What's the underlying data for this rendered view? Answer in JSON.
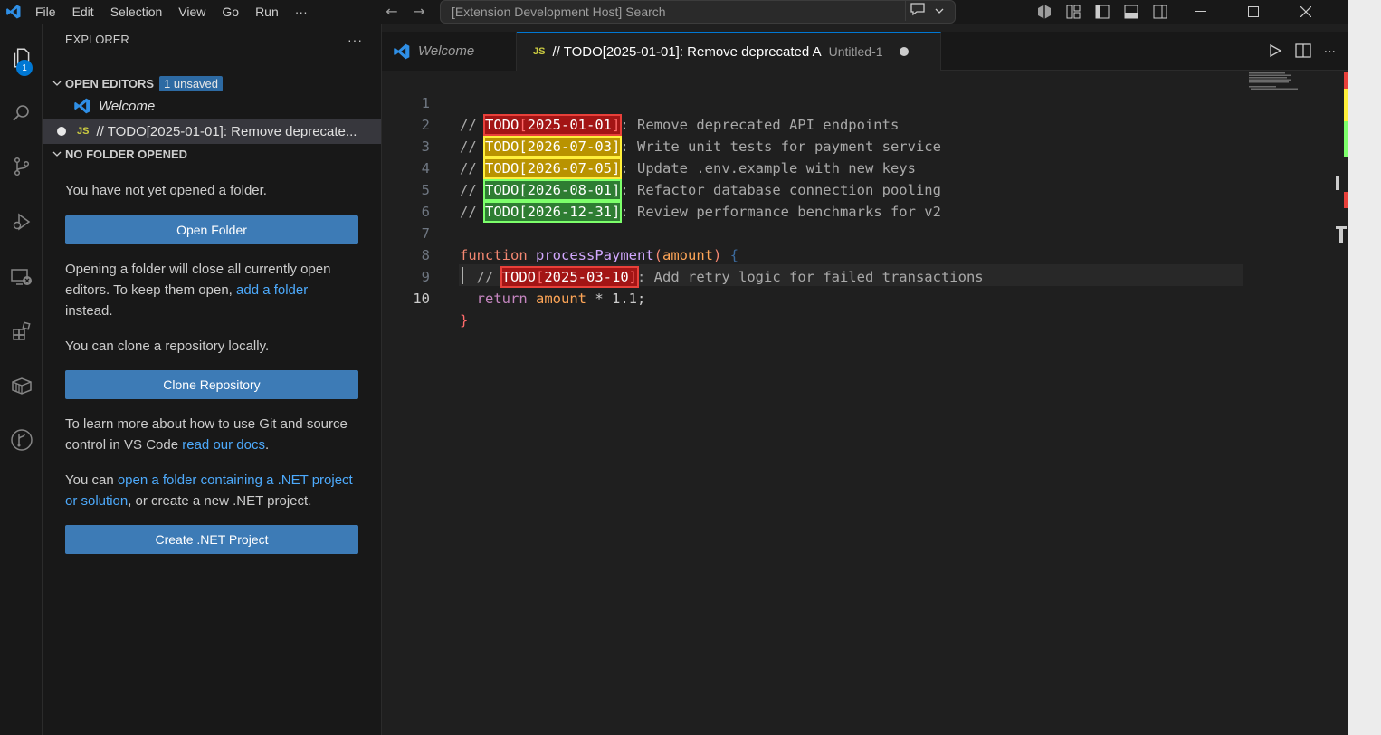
{
  "menu": [
    "File",
    "Edit",
    "Selection",
    "View",
    "Go",
    "Run"
  ],
  "menu_overflow": "···",
  "command_center": {
    "text": "[Extension Development Host] Search"
  },
  "activity": {
    "explorer_badge": "1"
  },
  "sidebar": {
    "title": "EXPLORER",
    "more": "···",
    "open_editors": {
      "title": "OPEN EDITORS",
      "badge": "1 unsaved",
      "items": [
        {
          "label": "Welcome",
          "icon": "vscode-icon"
        },
        {
          "label": "// TODO[2025-01-01]: Remove deprecate...",
          "icon": "js-icon",
          "icon_text": "JS"
        }
      ]
    },
    "no_folder": {
      "title": "NO FOLDER OPENED",
      "p1": "You have not yet opened a folder.",
      "open_folder": "Open Folder",
      "p2_a": "Opening a folder will close all currently open editors. To keep them open, ",
      "p2_link": "add a folder",
      "p2_b": " instead.",
      "p3": "You can clone a repository locally.",
      "clone": "Clone Repository",
      "p4_a": "To learn more about how to use Git and source control in VS Code ",
      "p4_link": "read our docs",
      "p4_b": ".",
      "p5_a": "You can ",
      "p5_link": "open a folder containing a .NET project or solution",
      "p5_b": ", or create a new .NET project.",
      "create_net": "Create .NET Project"
    }
  },
  "tabs": [
    {
      "label": "Welcome",
      "active": false
    },
    {
      "label": "// TODO[2025-01-01]: Remove deprecated A",
      "description": "Untitled-1",
      "active": true,
      "icon_text": "JS"
    }
  ],
  "code": {
    "line_numbers": [
      "1",
      "2",
      "3",
      "4",
      "5",
      "6",
      "7",
      "8",
      "9",
      "10"
    ],
    "todos": [
      {
        "prefix": "// ",
        "tag": "TODO",
        "date": "2025-01-01",
        "text": ": Remove deprecated API endpoints",
        "color": "red"
      },
      {
        "prefix": "// ",
        "tag": "TODO",
        "date": "2026-07-03",
        "text": ": Write unit tests for payment service",
        "color": "yellow"
      },
      {
        "prefix": "// ",
        "tag": "TODO",
        "date": "2026-07-05",
        "text": ": Update .env.example with new keys",
        "color": "yellow"
      },
      {
        "prefix": "// ",
        "tag": "TODO",
        "date": "2026-08-01",
        "text": ": Refactor database connection pooling",
        "color": "green"
      },
      {
        "prefix": "// ",
        "tag": "TODO",
        "date": "2026-12-31",
        "text": ": Review performance benchmarks for v2",
        "color": "green"
      }
    ],
    "line7": {
      "kw": "function",
      "name": "processPayment",
      "open": "(",
      "param": "amount",
      "close": ")",
      "brace": "{"
    },
    "line8": {
      "prefix": "// ",
      "tag": "TODO",
      "date": "2025-03-10",
      "text": ": Add retry logic for failed transactions",
      "color": "red"
    },
    "line9": {
      "kw": "return",
      "var": "amount",
      "rest": " * 1.1;"
    },
    "line10": {
      "brace": "}"
    }
  },
  "colors": {
    "accent": "#0078d4",
    "todo_red": "#a31515",
    "todo_yellow": "#b99300",
    "todo_green": "#2e7d32"
  }
}
